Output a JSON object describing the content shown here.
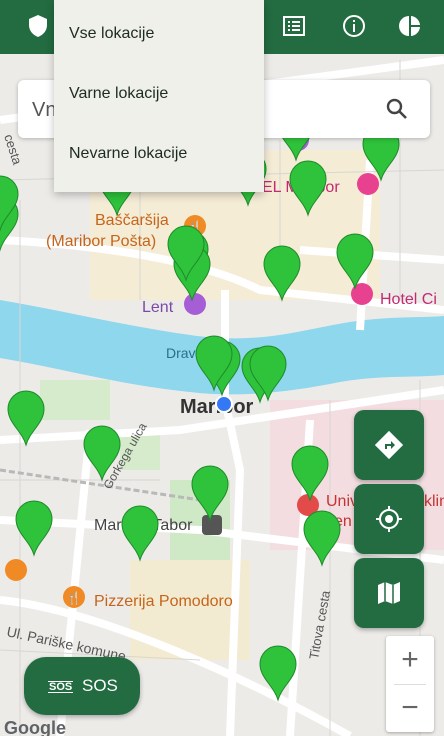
{
  "header": {
    "icons": [
      "shield-icon",
      "list-icon",
      "info-icon",
      "pie-chart-icon"
    ]
  },
  "search": {
    "placeholder": "Vnesi lokacijo",
    "value": "Vn"
  },
  "filter_menu": {
    "items": [
      "Vse lokacije",
      "Varne lokacije",
      "Nevarne lokacije"
    ]
  },
  "map": {
    "labels": {
      "city": "Maribor",
      "river": "Drava",
      "bascarsija": "Baščaršija",
      "bascarsija_sub": "(Maribor Pošta)",
      "lent": "Lent",
      "hotel_city": "Hotel Ci",
      "hotel_maribor": "EL Maribor",
      "gorkega": "Gorkega ulica",
      "maribor_tabor": "Maribor Tabor",
      "pizzeria": "Pizzerija Pomodoro",
      "ul_pariske": "Ul. Pariške komune",
      "titova": "Titova cesta",
      "hospital": "Univ",
      "hospital_2": "klin",
      "hospital_3": "cen",
      "google": "Google",
      "cesta": "cesta"
    },
    "markers_count_visible": 24,
    "accent_color": "#236b41",
    "marker_color": "#2fc23b"
  },
  "fabs": {
    "directions": "directions-icon",
    "my_location": "my-location-icon",
    "map_layers": "map-icon"
  },
  "zoom": {
    "in": "+",
    "out": "−"
  },
  "sos": {
    "badge": "SOS",
    "label": "SOS"
  }
}
